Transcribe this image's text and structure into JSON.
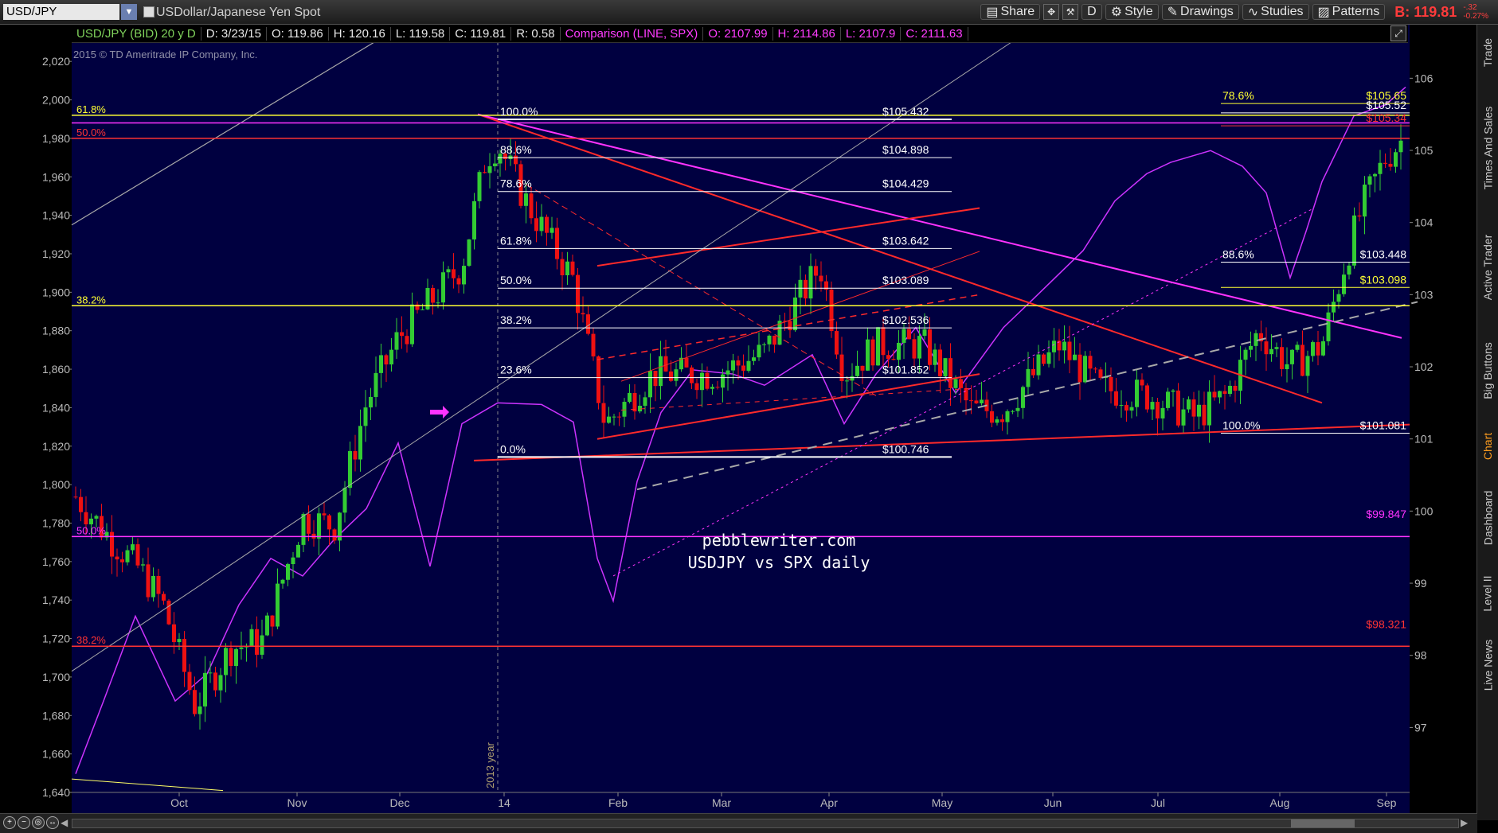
{
  "toolbar": {
    "symbol": "USD/JPY",
    "description": "USDollar/Japanese Yen Spot",
    "buttons": [
      "Share",
      "Style",
      "Drawings",
      "Studies",
      "Patterns"
    ],
    "d_label": "D",
    "bid_label": "B:",
    "bid_value": "119.81",
    "bid_change_1": "-.32",
    "bid_change_2": "-0.27%"
  },
  "infobar": {
    "title": "USD/JPY (BID) 20 y D",
    "date": "D: 3/23/15",
    "open": "O: 119.86",
    "high": "H: 120.16",
    "low": "L: 119.58",
    "close": "C: 119.81",
    "range": "R: 0.58",
    "comparison": "Comparison (LINE, SPX)",
    "c_open": "O: 2107.99",
    "c_high": "H: 2114.86",
    "c_low": "L: 2107.9",
    "c_close": "C: 2111.63"
  },
  "watermark": "2015 © TD Ameritrade IP Company, Inc.",
  "annotation": {
    "line1": "pebblewriter.com",
    "line2": "USDJPY vs SPX daily"
  },
  "year_marker": "2013 year",
  "colors": {
    "background": "#000040",
    "up_candle": "#33cc33",
    "down_candle": "#ee1111",
    "spx_line": "#cc33ff",
    "trend_red": "#ff2a2a",
    "trend_magenta": "#ff33ff",
    "fib_white": "#ffffff",
    "fib_yellow": "#ffff33"
  },
  "right_tabs": [
    "Trade",
    "Times And Sales",
    "Active Trader",
    "Big Buttons",
    "Chart",
    "Dashboard",
    "Level II",
    "Live News"
  ],
  "active_tab": "Chart",
  "chart_data": {
    "type": "candlestick",
    "left_axis": {
      "label": "SPX",
      "ticks": [
        "2,020",
        "2,000",
        "1,980",
        "1,960",
        "1,940",
        "1,920",
        "1,900",
        "1,880",
        "1,860",
        "1,840",
        "1,820",
        "1,800",
        "1,780",
        "1,760",
        "1,740",
        "1,720",
        "1,700",
        "1,680",
        "1,660",
        "1,640"
      ],
      "range": [
        1640,
        2030
      ]
    },
    "right_axis": {
      "label": "USDJPY",
      "ticks": [
        "106",
        "105",
        "104",
        "103",
        "102",
        "101",
        "100",
        "99",
        "98",
        "97"
      ],
      "range": [
        96.1,
        106.5
      ]
    },
    "x_labels": [
      "Oct",
      "Nov",
      "Dec",
      "14",
      "Feb",
      "Mar",
      "Apr",
      "May",
      "Jun",
      "Jul",
      "Aug",
      "Sep"
    ],
    "fib_levels_main": [
      {
        "pct": "100.0%",
        "price": "$105.432",
        "value": 105.43
      },
      {
        "pct": "88.6%",
        "price": "$104.898",
        "value": 104.9
      },
      {
        "pct": "78.6%",
        "price": "$104.429",
        "value": 104.43
      },
      {
        "pct": "61.8%",
        "price": "$103.642",
        "value": 103.64
      },
      {
        "pct": "50.0%",
        "price": "$103.089",
        "value": 103.09
      },
      {
        "pct": "38.2%",
        "price": "$102.536",
        "value": 102.54
      },
      {
        "pct": "23.6%",
        "price": "$101.852",
        "value": 101.85
      },
      {
        "pct": "0.0%",
        "price": "$100.746",
        "value": 100.75
      }
    ],
    "fib_levels_right": [
      {
        "pct": "78.6%",
        "price": "$105.65",
        "value": 105.65,
        "color": "#ffff33"
      },
      {
        "pct": "",
        "price": "$105.52",
        "value": 105.52,
        "color": "#ffffff"
      },
      {
        "pct": "",
        "price": "$105.34",
        "value": 105.34,
        "color": "#ff3333"
      },
      {
        "pct": "88.6%",
        "price": "$103.448",
        "value": 103.45,
        "color": "#ffffff"
      },
      {
        "pct": "",
        "price": "$103.098",
        "value": 103.1,
        "color": "#ffff33"
      },
      {
        "pct": "100.0%",
        "price": "$101.081",
        "value": 101.08,
        "color": "#ffffff"
      },
      {
        "pct": "",
        "price": "$99.847",
        "value": 99.85,
        "color": "#ff33ff"
      },
      {
        "pct": "",
        "price": "$98.321",
        "value": 98.32,
        "color": "#ff3333"
      }
    ],
    "left_fib_labels": [
      {
        "pct": "61.8%",
        "color": "#ffff33",
        "spx": 1992
      },
      {
        "pct": "50.0%",
        "color": "#ff3333",
        "spx": 1980
      },
      {
        "pct": "38.2%",
        "color": "#ffff33",
        "spx": 1893
      },
      {
        "pct": "50.0%",
        "color": "#ff33ff",
        "spx": 1773
      },
      {
        "pct": "38.2%",
        "color": "#ff3333",
        "spx": 1716
      }
    ]
  }
}
